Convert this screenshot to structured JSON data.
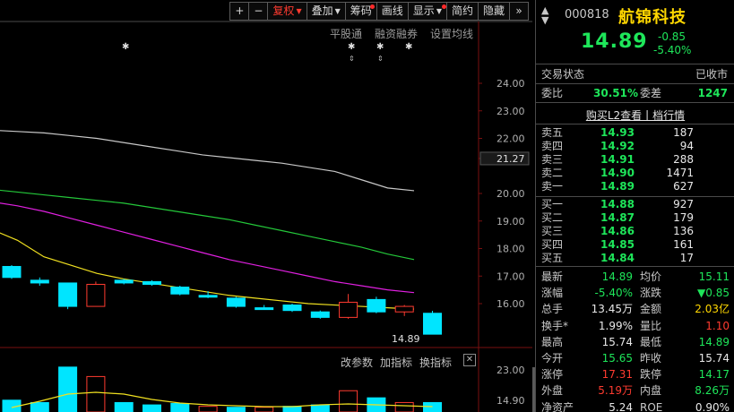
{
  "toolbar": {
    "plus": "+",
    "minus": "−",
    "fuquan": "复权",
    "diejia": "叠加",
    "chouma": "筹码",
    "huaxian": "画线",
    "xianshi": "显示",
    "jianyue": "简约",
    "yincang": "隐藏",
    "expand": "»"
  },
  "chart_links": {
    "pinggutong": "平股通",
    "rongzi": "融资融券",
    "shezhi": "设置均线"
  },
  "lower_panel": {
    "gaicanshu": "改参数",
    "jiazhibiao": "加指标",
    "huanzhibiao": "换指标",
    "close": "✕"
  },
  "stock": {
    "code": "000818",
    "name": "航锦科技",
    "price": "14.89",
    "change": "-0.85",
    "change_pct": "-5.40%"
  },
  "status": {
    "label": "交易状态",
    "value": "已收市",
    "weibi_label": "委比",
    "weibi": "30.51%",
    "weicha_label": "委差",
    "weicha": "1247"
  },
  "l2_link": "购买L2查看丨档行情",
  "sell_orders": [
    {
      "label": "卖五",
      "price": "14.93",
      "vol": "187"
    },
    {
      "label": "卖四",
      "price": "14.92",
      "vol": "94"
    },
    {
      "label": "卖三",
      "price": "14.91",
      "vol": "288"
    },
    {
      "label": "卖二",
      "price": "14.90",
      "vol": "1471"
    },
    {
      "label": "卖一",
      "price": "14.89",
      "vol": "627"
    }
  ],
  "buy_orders": [
    {
      "label": "买一",
      "price": "14.88",
      "vol": "927"
    },
    {
      "label": "买二",
      "price": "14.87",
      "vol": "179"
    },
    {
      "label": "买三",
      "price": "14.86",
      "vol": "136"
    },
    {
      "label": "买四",
      "price": "14.85",
      "vol": "161"
    },
    {
      "label": "买五",
      "price": "14.84",
      "vol": "17"
    }
  ],
  "stats": [
    {
      "l1": "最新",
      "v1": "14.89",
      "c1": "green",
      "l2": "均价",
      "v2": "15.11",
      "c2": "green"
    },
    {
      "l1": "涨幅",
      "v1": "-5.40%",
      "c1": "green",
      "l2": "涨跌",
      "v2": "▼0.85",
      "c2": "green"
    },
    {
      "l1": "总手",
      "v1": "13.45万",
      "c1": "white",
      "l2": "金额",
      "v2": "2.03亿",
      "c2": "yellow"
    },
    {
      "l1": "换手*",
      "v1": "1.99%",
      "c1": "white",
      "l2": "量比",
      "v2": "1.10",
      "c2": "red"
    },
    {
      "l1": "最高",
      "v1": "15.74",
      "c1": "white",
      "l2": "最低",
      "v2": "14.89",
      "c2": "green"
    },
    {
      "l1": "今开",
      "v1": "15.65",
      "c1": "green",
      "l2": "昨收",
      "v2": "15.74",
      "c2": "white"
    },
    {
      "l1": "涨停",
      "v1": "17.31",
      "c1": "red",
      "l2": "跌停",
      "v2": "14.17",
      "c2": "green"
    },
    {
      "l1": "外盘",
      "v1": "5.19万",
      "c1": "red",
      "l2": "内盘",
      "v2": "8.26万",
      "c2": "green"
    },
    {
      "l1": "净资产",
      "v1": "5.24",
      "c1": "white",
      "l2": "ROE",
      "v2": "0.90%",
      "c2": "white"
    }
  ],
  "price_axis": [
    "24.00",
    "23.00",
    "22.00",
    "21.27",
    "20.00",
    "19.00",
    "18.00",
    "17.00",
    "16.00"
  ],
  "last_price_label": "14.89",
  "lower_axis": [
    "23.00",
    "14.90"
  ],
  "chart_data": {
    "type": "candlestick",
    "ylim": [
      14.5,
      24.5
    ],
    "current_price": 14.89,
    "candles": [
      {
        "o": 17.35,
        "c": 16.95,
        "h": 17.4,
        "l": 16.9
      },
      {
        "o": 16.85,
        "c": 16.75,
        "h": 16.95,
        "l": 16.65
      },
      {
        "o": 16.75,
        "c": 15.9,
        "h": 16.75,
        "l": 15.8
      },
      {
        "o": 15.9,
        "c": 16.7,
        "h": 16.8,
        "l": 15.9
      },
      {
        "o": 16.85,
        "c": 16.75,
        "h": 16.9,
        "l": 16.7
      },
      {
        "o": 16.8,
        "c": 16.7,
        "h": 16.85,
        "l": 16.65
      },
      {
        "o": 16.6,
        "c": 16.35,
        "h": 16.65,
        "l": 16.3
      },
      {
        "o": 16.3,
        "c": 16.3,
        "h": 16.45,
        "l": 16.2
      },
      {
        "o": 16.2,
        "c": 15.9,
        "h": 16.25,
        "l": 15.85
      },
      {
        "o": 15.85,
        "c": 15.85,
        "h": 15.95,
        "l": 15.8
      },
      {
        "o": 15.95,
        "c": 15.75,
        "h": 16.0,
        "l": 15.7
      },
      {
        "o": 15.7,
        "c": 15.5,
        "h": 15.75,
        "l": 15.45
      },
      {
        "o": 15.5,
        "c": 16.05,
        "h": 16.35,
        "l": 15.45
      },
      {
        "o": 16.15,
        "c": 15.7,
        "h": 16.25,
        "l": 15.65
      },
      {
        "o": 15.7,
        "c": 15.9,
        "h": 15.95,
        "l": 15.55
      },
      {
        "o": 15.65,
        "c": 14.89,
        "h": 15.74,
        "l": 14.89
      }
    ],
    "ma_white": [
      22.3,
      22.25,
      22.2,
      22.1,
      22.0,
      21.85,
      21.7,
      21.55,
      21.4,
      21.3,
      21.2,
      21.1,
      20.95,
      20.8,
      20.5,
      20.2,
      20.1,
      20.0
    ],
    "ma_green": [
      20.15,
      20.05,
      19.95,
      19.85,
      19.75,
      19.65,
      19.5,
      19.35,
      19.2,
      19.05,
      18.85,
      18.65,
      18.45,
      18.25,
      18.05,
      17.8,
      17.6,
      17.4
    ],
    "ma_magenta": [
      19.7,
      19.55,
      19.35,
      19.1,
      18.85,
      18.6,
      18.35,
      18.1,
      17.85,
      17.6,
      17.4,
      17.2,
      17.0,
      16.8,
      16.65,
      16.5,
      16.4,
      16.3
    ],
    "ma_yellow": [
      18.7,
      18.3,
      17.7,
      17.4,
      17.1,
      16.9,
      16.75,
      16.6,
      16.45,
      16.3,
      16.2,
      16.1,
      16.0,
      15.95,
      15.9,
      15.85,
      15.8,
      15.75
    ],
    "colors": {
      "up": "#ff3b30",
      "down": "#00e5ff",
      "ma1": "#c8c8c8",
      "ma2": "#24c83a",
      "ma3": "#e020e0",
      "ma4": "#f0e020"
    }
  }
}
